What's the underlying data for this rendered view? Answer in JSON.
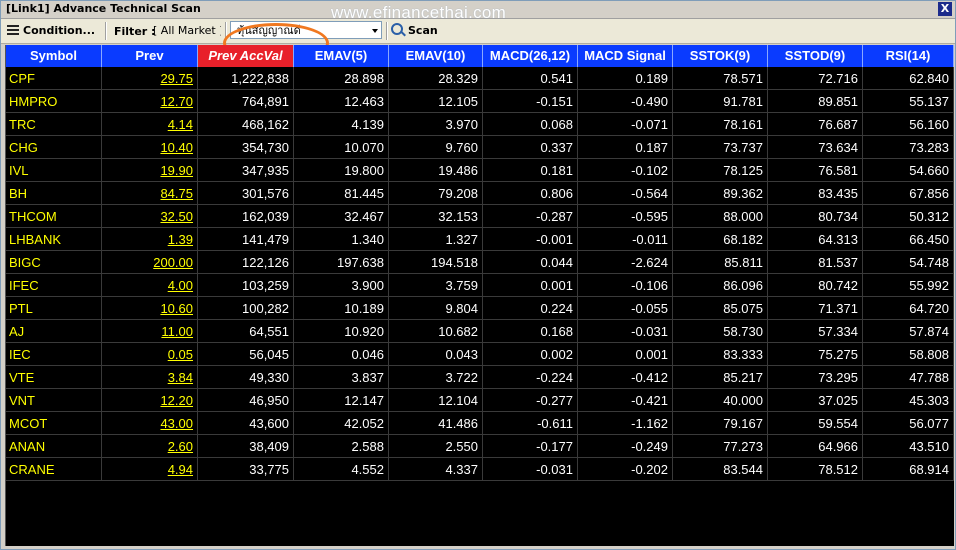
{
  "window": {
    "title": "[Link1] Advance Technical Scan",
    "watermark": "www.efinancethai.com",
    "close": "X"
  },
  "toolbar": {
    "condition_label": "Condition...",
    "filter_label": "Filter :",
    "filter_value": "[ All Market ]",
    "combo_value": "หุ้นสัญญาณดี",
    "scan_label": "Scan"
  },
  "table": {
    "columns": [
      "Symbol",
      "Prev",
      "Prev AccVal",
      "EMAV(5)",
      "EMAV(10)",
      "MACD(26,12)",
      "MACD Signal",
      "SSTOK(9)",
      "SSTOD(9)",
      "RSI(14)"
    ],
    "rows": [
      [
        "CPF",
        "29.75",
        "1,222,838",
        "28.898",
        "28.329",
        "0.541",
        "0.189",
        "78.571",
        "72.716",
        "62.840"
      ],
      [
        "HMPRO",
        "12.70",
        "764,891",
        "12.463",
        "12.105",
        "-0.151",
        "-0.490",
        "91.781",
        "89.851",
        "55.137"
      ],
      [
        "TRC",
        "4.14",
        "468,162",
        "4.139",
        "3.970",
        "0.068",
        "-0.071",
        "78.161",
        "76.687",
        "56.160"
      ],
      [
        "CHG",
        "10.40",
        "354,730",
        "10.070",
        "9.760",
        "0.337",
        "0.187",
        "73.737",
        "73.634",
        "73.283"
      ],
      [
        "IVL",
        "19.90",
        "347,935",
        "19.800",
        "19.486",
        "0.181",
        "-0.102",
        "78.125",
        "76.581",
        "54.660"
      ],
      [
        "BH",
        "84.75",
        "301,576",
        "81.445",
        "79.208",
        "0.806",
        "-0.564",
        "89.362",
        "83.435",
        "67.856"
      ],
      [
        "THCOM",
        "32.50",
        "162,039",
        "32.467",
        "32.153",
        "-0.287",
        "-0.595",
        "88.000",
        "80.734",
        "50.312"
      ],
      [
        "LHBANK",
        "1.39",
        "141,479",
        "1.340",
        "1.327",
        "-0.001",
        "-0.011",
        "68.182",
        "64.313",
        "66.450"
      ],
      [
        "BIGC",
        "200.00",
        "122,126",
        "197.638",
        "194.518",
        "0.044",
        "-2.624",
        "85.811",
        "81.537",
        "54.748"
      ],
      [
        "IFEC",
        "4.00",
        "103,259",
        "3.900",
        "3.759",
        "0.001",
        "-0.106",
        "86.096",
        "80.742",
        "55.992"
      ],
      [
        "PTL",
        "10.60",
        "100,282",
        "10.189",
        "9.804",
        "0.224",
        "-0.055",
        "85.075",
        "71.371",
        "64.720"
      ],
      [
        "AJ",
        "11.00",
        "64,551",
        "10.920",
        "10.682",
        "0.168",
        "-0.031",
        "58.730",
        "57.334",
        "57.874"
      ],
      [
        "IEC",
        "0.05",
        "56,045",
        "0.046",
        "0.043",
        "0.002",
        "0.001",
        "83.333",
        "75.275",
        "58.808"
      ],
      [
        "VTE",
        "3.84",
        "49,330",
        "3.837",
        "3.722",
        "-0.224",
        "-0.412",
        "85.217",
        "73.295",
        "47.788"
      ],
      [
        "VNT",
        "12.20",
        "46,950",
        "12.147",
        "12.104",
        "-0.277",
        "-0.421",
        "40.000",
        "37.025",
        "45.303"
      ],
      [
        "MCOT",
        "43.00",
        "43,600",
        "42.052",
        "41.486",
        "-0.611",
        "-1.162",
        "79.167",
        "59.554",
        "56.077"
      ],
      [
        "ANAN",
        "2.60",
        "38,409",
        "2.588",
        "2.550",
        "-0.177",
        "-0.249",
        "77.273",
        "64.966",
        "43.510"
      ],
      [
        "CRANE",
        "4.94",
        "33,775",
        "4.552",
        "4.337",
        "-0.031",
        "-0.202",
        "83.544",
        "78.512",
        "68.914"
      ]
    ]
  }
}
